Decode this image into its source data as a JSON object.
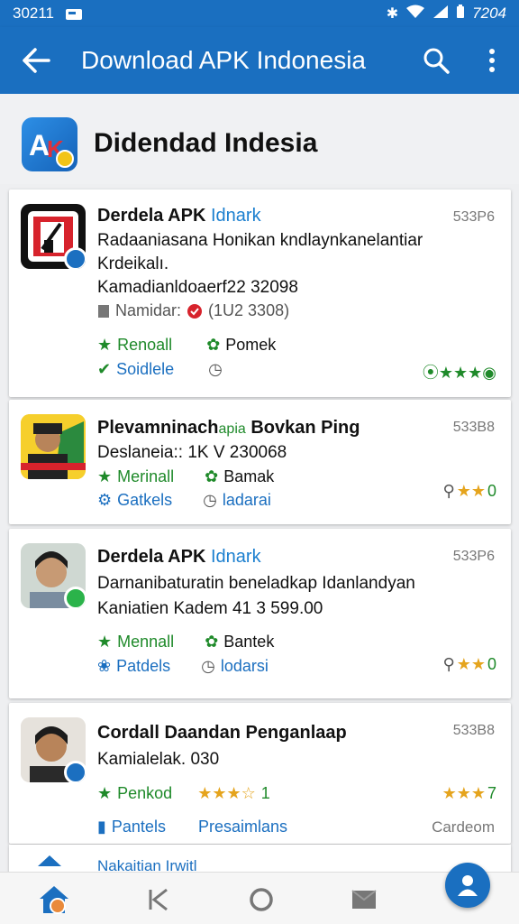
{
  "status_bar": {
    "left_text": "30211",
    "time": "7204"
  },
  "app_bar": {
    "title": "Download APK Indonesia"
  },
  "header": {
    "title": "Didendad Indesia"
  },
  "cards": [
    {
      "size": "533P6",
      "title": "Derdela APK",
      "title_accent": "Idnark",
      "lines": [
        "Radaaniasana Honikan kndlaynkanelantiar",
        "Krdeikalı.",
        "Kamadianldoaerf22 32098"
      ],
      "info_label": "Namidar:",
      "info_value": "(1U2 3308)",
      "meta": [
        {
          "icon": "star-icon",
          "label": "Renoall",
          "color": "#1f8a2a"
        },
        {
          "icon": "gear-icon",
          "label": "Pomek",
          "color": "#1f8a2a"
        },
        {
          "icon": "check-circle-icon",
          "label": "Soidlele",
          "color": "#1b6fc0"
        },
        {
          "icon": "clock-icon",
          "label": "",
          "color": "#666666"
        }
      ],
      "rating": "",
      "rating_color": "#1f8a2a"
    },
    {
      "size": "533B8",
      "title": "Plevamninach",
      "title_accent": "apia",
      "title_rest": "Bovkan Ping",
      "lines": [
        "Deslaneia:: 1K V 230068"
      ],
      "meta": [
        {
          "icon": "star-icon",
          "label": "Merinall",
          "color": "#1f8a2a"
        },
        {
          "icon": "gear-icon",
          "label": "Bamak",
          "color": "#1f8a2a"
        },
        {
          "icon": "gear-icon",
          "label": "Gatkels",
          "color": "#1b6fc0"
        },
        {
          "icon": "clock-icon",
          "label": "ladarai",
          "color": "#1b6fc0"
        }
      ],
      "rating": "0"
    },
    {
      "size": "533P6",
      "title": "Derdela APK",
      "title_accent": "Idnark",
      "lines": [
        "Darnanibaturatin beneladkap Idanlandyan",
        "Kaniatien Kadem 41 3 599.00"
      ],
      "meta": [
        {
          "icon": "star-icon",
          "label": "Mennall",
          "color": "#1f8a2a"
        },
        {
          "icon": "gear-icon",
          "label": "Bantek",
          "color": "#1f8a2a"
        },
        {
          "icon": "award-icon",
          "label": "Patdels",
          "color": "#1b6fc0"
        },
        {
          "icon": "clock-icon",
          "label": "lodarsi",
          "color": "#1b6fc0"
        }
      ],
      "rating": "0"
    },
    {
      "size": "533B8",
      "title": "Cordall Daandan Penganlaap",
      "lines": [
        "Kamialelak. 030"
      ],
      "meta": [
        {
          "icon": "star-icon",
          "label": "Penkod",
          "color": "#1f8a2a"
        },
        {
          "icon": "stars-icon",
          "label": "1",
          "color": "#1f8a2a"
        },
        {
          "icon": "doc-icon",
          "label": "Pantels",
          "color": "#1b6fc0"
        },
        {
          "icon": "",
          "label": "Presaimlans",
          "color": "#1b6fc0"
        }
      ],
      "rating": "7",
      "corner_label": "Cardeom"
    }
  ],
  "peek_card": {
    "label": "Nakaitian Irwitl"
  }
}
